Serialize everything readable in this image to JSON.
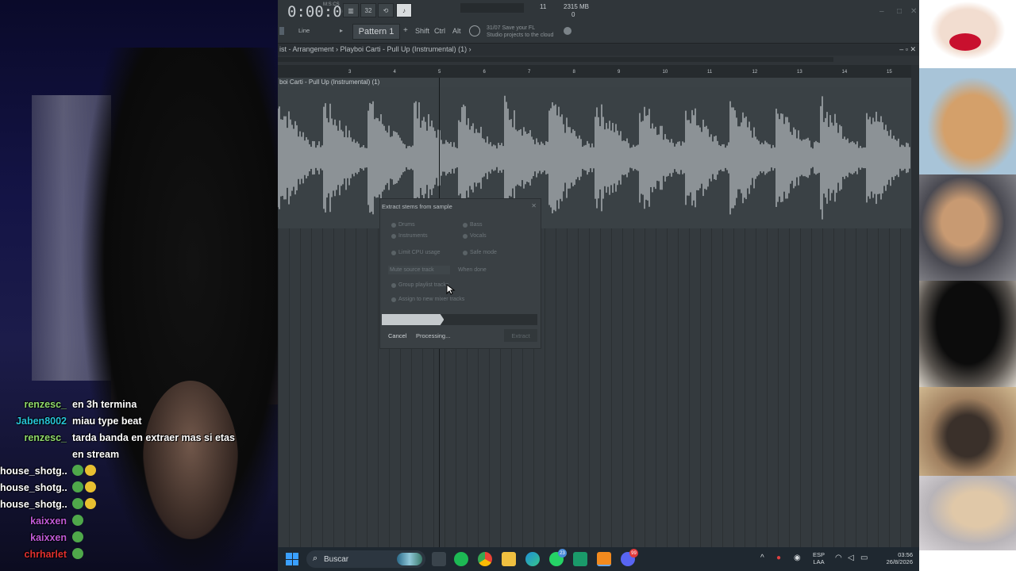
{
  "chat": [
    {
      "user": "renzesc_",
      "text": "en 3h termina",
      "color": "#8fd96a"
    },
    {
      "user": "Jaben8002",
      "text": "miau type beat",
      "color": "#27c4d8"
    },
    {
      "user": "renzesc_",
      "text": "tarda banda en extraer mas si etas en stream",
      "color": "#8fd96a"
    },
    {
      "user": "house_shotg...",
      "text": "",
      "color": "#ffffff",
      "emotes": 2
    },
    {
      "user": "house_shotg...",
      "text": "",
      "color": "#ffffff",
      "emotes": 2
    },
    {
      "user": "house_shotg...",
      "text": "",
      "color": "#ffffff",
      "emotes": 2
    },
    {
      "user": "kaixxen",
      "text": "",
      "color": "#c05ad8",
      "emotes": 1
    },
    {
      "user": "kaixxen",
      "text": "",
      "color": "#c05ad8",
      "emotes": 1
    },
    {
      "user": "chrharlet",
      "text": "",
      "color": "#e03030",
      "emotes": 1
    }
  ],
  "daw": {
    "time": "0:00:00",
    "time_unit": "M:S:CS",
    "cpu_value": "11",
    "memory": "2315 MB",
    "cpu_zero": "0",
    "snap": "Line",
    "pattern": "Pattern 1",
    "keys": [
      "Shift",
      "Ctrl",
      "Alt"
    ],
    "hint_line1": "31/07  Save your FL",
    "hint_line2": "Studio projects to the cloud",
    "playlist_title": "ist - Arrangement › Playboi Carti - Pull Up (Instrumental) (1) ›",
    "clip_label": "boi Carti - Pull Up (Instrumental) (1)",
    "ruler_ticks": [
      "3",
      "4",
      "5",
      "6",
      "7",
      "8",
      "9",
      "10",
      "11",
      "12",
      "13",
      "14",
      "15"
    ]
  },
  "dialog": {
    "title": "Extract stems from sample",
    "options": [
      "Drums",
      "Bass",
      "Instruments",
      "Vocals"
    ],
    "limit_cpu": "Limit CPU usage",
    "safe_mode": "Safe mode",
    "mute_field": "Mute source track",
    "when_done": "When done",
    "group_playlist": "Group playlist tracks",
    "assign_mixer": "Assign to new mixer tracks",
    "progress": 0.4,
    "cancel": "Cancel",
    "status": "Processing...",
    "extract": "Extract"
  },
  "taskbar": {
    "search_placeholder": "Buscar",
    "badges": {
      "whatsapp": "23",
      "discord": "99"
    },
    "lang_line1": "ESP",
    "lang_line2": "LAA",
    "time": "03:56",
    "date": "26/8/2026"
  }
}
